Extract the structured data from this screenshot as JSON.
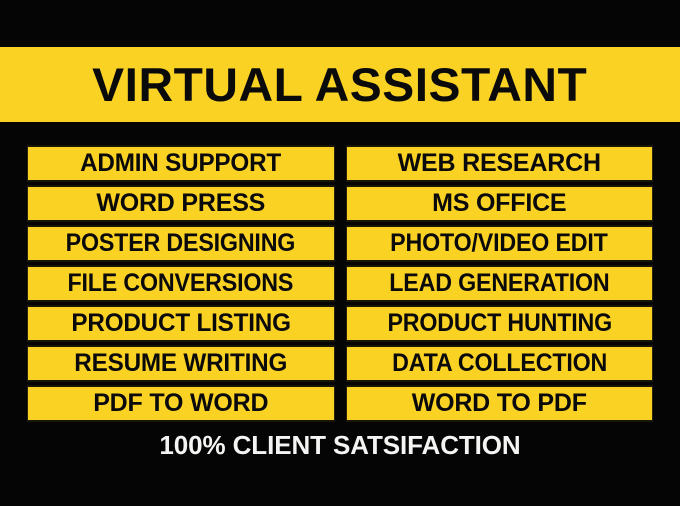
{
  "poster": {
    "title": "VIRTUAL ASSISTANT",
    "footer_text": "100% CLIENT SATSIFACTION",
    "colors": {
      "background": "#050505",
      "accent_yellow": "#FAD224",
      "banner_yellow": "#FAD224",
      "title_text": "#0A0A0A",
      "pill_text": "#0A0A0A",
      "footer_text": "#F4F4F2",
      "pill_border": "#1a1605"
    }
  },
  "services": {
    "rows": [
      {
        "left": "ADMIN SUPPORT",
        "right": "WEB RESEARCH"
      },
      {
        "left": "WORD PRESS",
        "right": "MS OFFICE"
      },
      {
        "left": "POSTER DESIGNING",
        "right": "PHOTO/VIDEO EDIT"
      },
      {
        "left": "FILE CONVERSIONS",
        "right": "LEAD GENERATION"
      },
      {
        "left": "PRODUCT LISTING",
        "right": "PRODUCT HUNTING"
      },
      {
        "left": "RESUME WRITING",
        "right": "DATA COLLECTION"
      },
      {
        "left": "PDF TO WORD",
        "right": "WORD TO PDF"
      }
    ]
  }
}
